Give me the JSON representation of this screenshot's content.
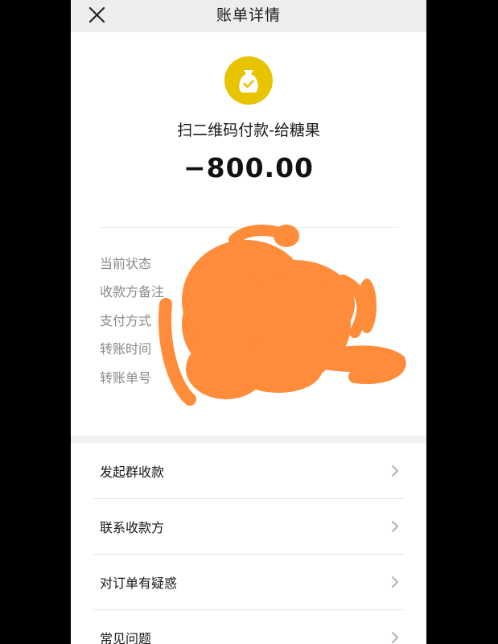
{
  "header": {
    "title": "账单详情"
  },
  "summary": {
    "merchant": "扫二维码付款-给糖果",
    "amount": "−800.00",
    "icon": "money-bag-icon",
    "icon_color": "#e8c300"
  },
  "details": [
    {
      "label": "当前状态"
    },
    {
      "label": "收款方备注"
    },
    {
      "label": "支付方式"
    },
    {
      "label": "转账时间"
    },
    {
      "label": "转账单号"
    }
  ],
  "menu": [
    {
      "label": "发起群收款"
    },
    {
      "label": "联系收款方"
    },
    {
      "label": "对订单有疑惑"
    },
    {
      "label": "常见问题"
    }
  ],
  "colors": {
    "redaction": "#ff8c3a",
    "header_bg": "#ededed"
  }
}
